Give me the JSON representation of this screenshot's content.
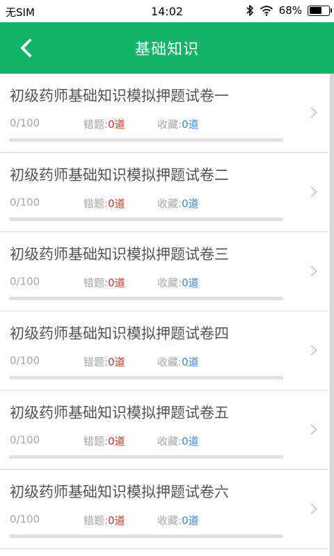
{
  "status_bar": {
    "carrier": "无SIM",
    "time": "14:02",
    "battery": "68%",
    "battery_level": 0.68
  },
  "header": {
    "title": "基础知识"
  },
  "labels": {
    "wrong": "错题:",
    "fav": "收藏:"
  },
  "items": [
    {
      "title": "初级药师基础知识模拟押题试卷一",
      "progress": "0/100",
      "wrong": "0道",
      "fav": "0道",
      "progress_fraction": 0
    },
    {
      "title": "初级药师基础知识模拟押题试卷二",
      "progress": "0/100",
      "wrong": "0道",
      "fav": "0道",
      "progress_fraction": 0
    },
    {
      "title": "初级药师基础知识模拟押题试卷三",
      "progress": "0/100",
      "wrong": "0道",
      "fav": "0道",
      "progress_fraction": 0
    },
    {
      "title": "初级药师基础知识模拟押题试卷四",
      "progress": "0/100",
      "wrong": "0道",
      "fav": "0道",
      "progress_fraction": 0
    },
    {
      "title": "初级药师基础知识模拟押题试卷五",
      "progress": "0/100",
      "wrong": "0道",
      "fav": "0道",
      "progress_fraction": 0
    },
    {
      "title": "初级药师基础知识模拟押题试卷六",
      "progress": "0/100",
      "wrong": "0道",
      "fav": "0道",
      "progress_fraction": 0
    }
  ],
  "colors": {
    "accent": "#14b36a",
    "wrong": "#c0392b",
    "fav": "#3f86cc"
  }
}
